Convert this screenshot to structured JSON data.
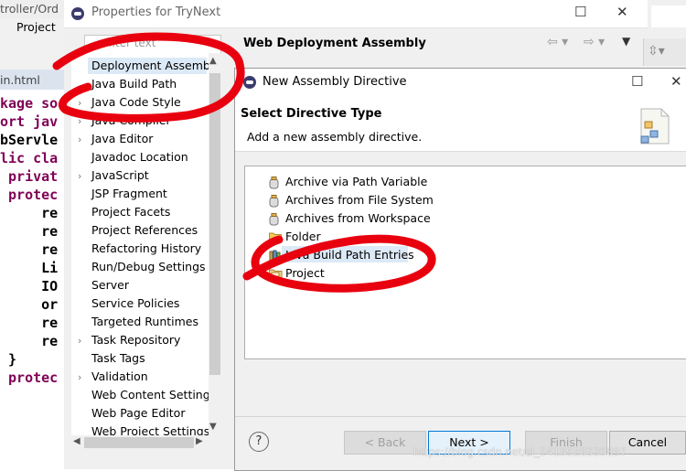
{
  "editor": {
    "tab_label": "troller/Ord",
    "menu_project": "Project",
    "file_tab": "in.html",
    "code_lines": [
      {
        "text": "kage so",
        "kw": true
      },
      {
        "text": "",
        "kw": false
      },
      {
        "text": "ort jav",
        "kw": true
      },
      {
        "text": "bServle",
        "kw": false
      },
      {
        "text": "lic cla",
        "kw": true
      },
      {
        "text": " privat",
        "kw": true
      },
      {
        "text": " protec",
        "kw": true
      },
      {
        "text": "",
        "kw": false
      },
      {
        "text": "     re",
        "kw": false
      },
      {
        "text": "     re",
        "kw": false
      },
      {
        "text": "     re",
        "kw": false
      },
      {
        "text": "     Li",
        "kw": false
      },
      {
        "text": "     IO",
        "kw": false
      },
      {
        "text": "     or",
        "kw": false
      },
      {
        "text": "     re",
        "kw": false
      },
      {
        "text": "     re",
        "kw": false
      },
      {
        "text": "",
        "kw": false
      },
      {
        "text": " }",
        "kw": false
      },
      {
        "text": " protec",
        "kw": true
      }
    ]
  },
  "properties": {
    "title": "Properties for TryNext",
    "filter_placeholder": "filter text",
    "tree": [
      {
        "label": "Deployment Assembly",
        "selected": true,
        "expandable": false
      },
      {
        "label": "Java Build Path",
        "selected": false,
        "expandable": false
      },
      {
        "label": "Java Code Style",
        "selected": false,
        "expandable": true
      },
      {
        "label": "Java Compiler",
        "selected": false,
        "expandable": true
      },
      {
        "label": "Java Editor",
        "selected": false,
        "expandable": true
      },
      {
        "label": "Javadoc Location",
        "selected": false,
        "expandable": false
      },
      {
        "label": "JavaScript",
        "selected": false,
        "expandable": true
      },
      {
        "label": "JSP Fragment",
        "selected": false,
        "expandable": false
      },
      {
        "label": "Project Facets",
        "selected": false,
        "expandable": false
      },
      {
        "label": "Project References",
        "selected": false,
        "expandable": false
      },
      {
        "label": "Refactoring History",
        "selected": false,
        "expandable": false
      },
      {
        "label": "Run/Debug Settings",
        "selected": false,
        "expandable": false
      },
      {
        "label": "Server",
        "selected": false,
        "expandable": false
      },
      {
        "label": "Service Policies",
        "selected": false,
        "expandable": false
      },
      {
        "label": "Targeted Runtimes",
        "selected": false,
        "expandable": false
      },
      {
        "label": "Task Repository",
        "selected": false,
        "expandable": true
      },
      {
        "label": "Task Tags",
        "selected": false,
        "expandable": false
      },
      {
        "label": "Validation",
        "selected": false,
        "expandable": true
      },
      {
        "label": "Web Content Settings",
        "selected": false,
        "expandable": false
      },
      {
        "label": "Web Page Editor",
        "selected": false,
        "expandable": false
      },
      {
        "label": "Web Project Settings",
        "selected": false,
        "expandable": false
      }
    ],
    "page_title": "Web Deployment Assembly"
  },
  "dialog": {
    "title": "New Assembly Directive",
    "header_title": "Select Directive Type",
    "header_desc": "Add a new assembly directive.",
    "types": [
      {
        "label": "Archive via Path Variable",
        "icon": "jar-icon",
        "selected": false
      },
      {
        "label": "Archives from File System",
        "icon": "jar-icon",
        "selected": false
      },
      {
        "label": "Archives from Workspace",
        "icon": "jar-icon",
        "selected": false
      },
      {
        "label": "Folder",
        "icon": "folder-icon",
        "selected": false
      },
      {
        "label": "Java Build Path Entries",
        "icon": "library-icon",
        "selected": true
      },
      {
        "label": "Project",
        "icon": "project-icon",
        "selected": false
      }
    ],
    "buttons": {
      "back": "< Back",
      "next": "Next >",
      "finish": "Finish",
      "cancel": "Cancel"
    }
  },
  "watermark": "https://blog.csdn.net/zl_1415926535897",
  "colors": {
    "annotation_red": "#e8000f",
    "selection": "#dce9f6",
    "keyword": "#7f0055"
  }
}
